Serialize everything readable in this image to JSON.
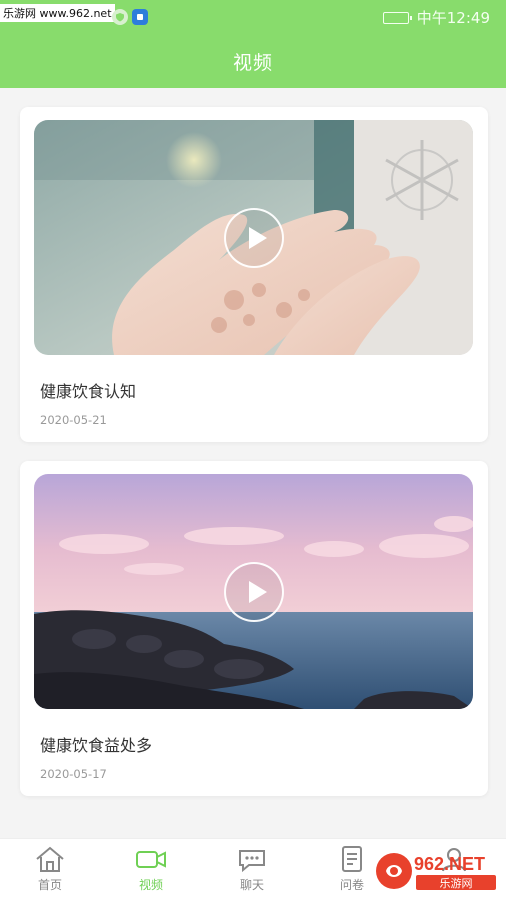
{
  "status_bar": {
    "watermark": "乐游网 www.962.net",
    "time": "中午12:49"
  },
  "header": {
    "title": "视频"
  },
  "videos": [
    {
      "title": "健康饮食认知",
      "date": "2020-05-21"
    },
    {
      "title": "健康饮食益处多",
      "date": "2020-05-17"
    }
  ],
  "tabbar": {
    "items": [
      {
        "label": "首页",
        "icon": "home-icon",
        "active": false
      },
      {
        "label": "视频",
        "icon": "video-camera-icon",
        "active": true
      },
      {
        "label": "聊天",
        "icon": "chat-bubble-icon",
        "active": false
      },
      {
        "label": "问卷",
        "icon": "questionnaire-icon",
        "active": false
      },
      {
        "label": "",
        "icon": "profile-icon",
        "active": false
      }
    ]
  },
  "watermark_logo": {
    "text": "962.NET",
    "sub": "乐游网"
  },
  "colors": {
    "header": "#88dc6c",
    "active_tab": "#6fd054"
  }
}
